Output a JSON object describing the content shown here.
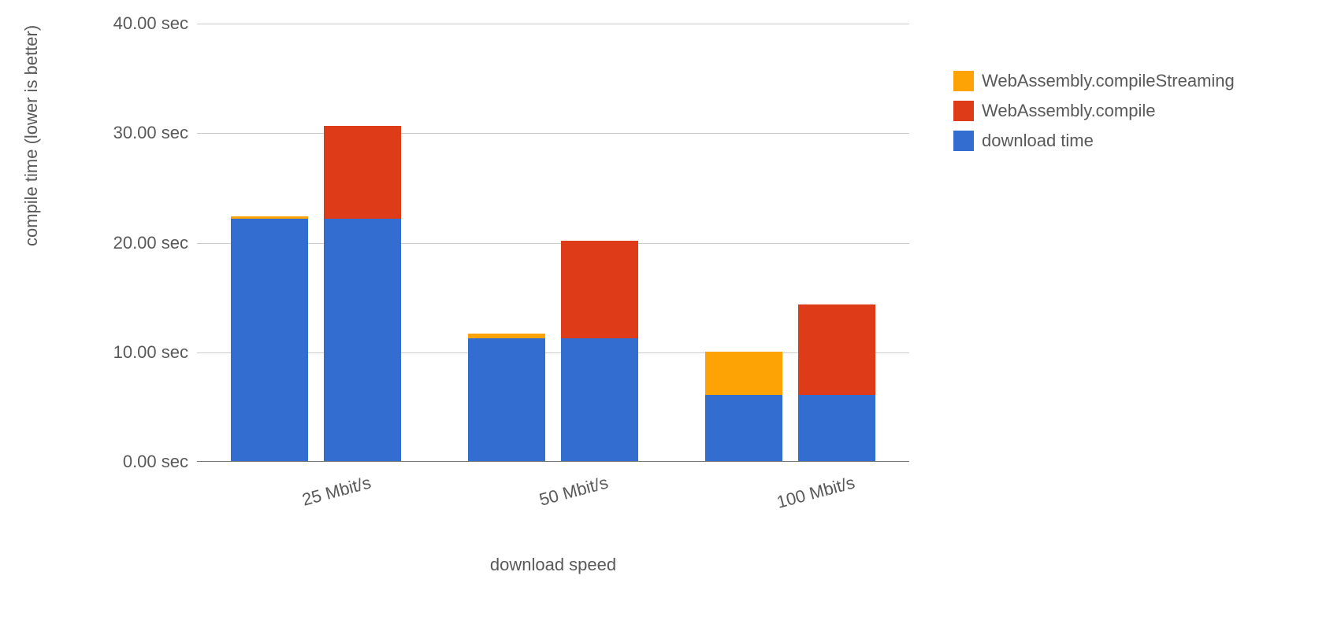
{
  "chart_data": {
    "type": "bar",
    "categories": [
      "25 Mbit/s",
      "50 Mbit/s",
      "100 Mbit/s"
    ],
    "groups": [
      {
        "bars": [
          {
            "download_time": 22.1,
            "compile_streaming": 0.2,
            "compile": 0
          },
          {
            "download_time": 22.1,
            "compile_streaming": 0,
            "compile": 8.5
          }
        ]
      },
      {
        "bars": [
          {
            "download_time": 11.2,
            "compile_streaming": 0.4,
            "compile": 0
          },
          {
            "download_time": 11.2,
            "compile_streaming": 0,
            "compile": 8.9
          }
        ]
      },
      {
        "bars": [
          {
            "download_time": 6.0,
            "compile_streaming": 4.0,
            "compile": 0
          },
          {
            "download_time": 6.0,
            "compile_streaming": 0,
            "compile": 8.3
          }
        ]
      }
    ],
    "series_legend": [
      {
        "name": "WebAssembly.compileStreaming",
        "color": "#fea305",
        "key": "compile_streaming"
      },
      {
        "name": "WebAssembly.compile",
        "color": "#de3b19",
        "key": "compile"
      },
      {
        "name": "download time",
        "color": "#326dcf",
        "key": "download_time"
      }
    ],
    "xlabel": "download speed",
    "ylabel": "compile time (lower is better)",
    "ylim": [
      0,
      40
    ],
    "y_ticks": [
      "0.00 sec",
      "10.00 sec",
      "20.00 sec",
      "30.00 sec",
      "40.00 sec"
    ],
    "title": ""
  }
}
